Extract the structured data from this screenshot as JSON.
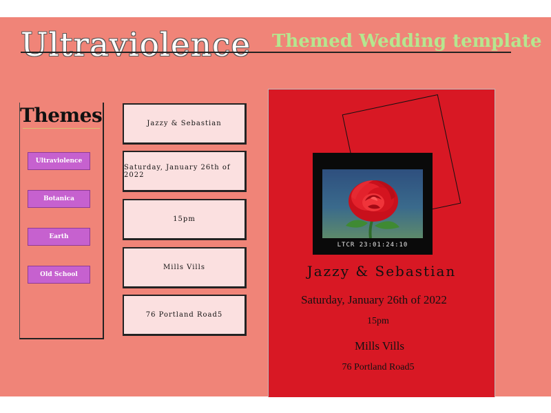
{
  "header": {
    "title": "Ultraviolence",
    "subtitle": "Themed Wedding template"
  },
  "themes": {
    "title": "Themes",
    "items": [
      "Ultraviolence",
      "Botanica",
      "Earth",
      "Old School"
    ]
  },
  "fields": [
    "Jazzy & Sebastian",
    "Saturday, January 26th of 2022",
    "15pm",
    "Mills Vills",
    "76  Portland Road5"
  ],
  "card": {
    "names": "Jazzy & Sebastian",
    "date": "Saturday, January 26th of 2022",
    "time": "15pm",
    "venue": "Mills Vills",
    "address": "76 Portland Road5",
    "timecode": "LTCR 23:01:24:10",
    "image": "red-rose-photo"
  },
  "colors": {
    "page_bg": "#f08478",
    "title_text": "#ffffff",
    "subtitle_text": "#b6e68f",
    "theme_button": "#c661cf",
    "field_bg": "#fbe0e0",
    "card_bg": "#d81824"
  }
}
